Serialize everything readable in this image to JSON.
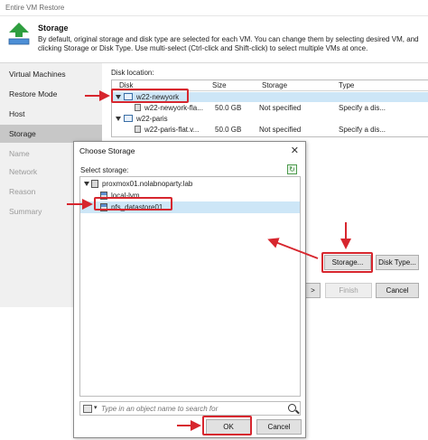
{
  "window": {
    "title": "Entire VM Restore"
  },
  "header": {
    "title": "Storage",
    "description": "By default, original storage and disk type are selected for each VM. You can change them by selecting desired VM, and clicking Storage or Disk Type. Use multi-select (Ctrl-click and Shift-click) to select multiple VMs at once."
  },
  "sidebar": {
    "items": [
      {
        "label": "Virtual Machines",
        "state": "normal"
      },
      {
        "label": "Restore Mode",
        "state": "normal"
      },
      {
        "label": "Host",
        "state": "normal"
      },
      {
        "label": "Storage",
        "state": "active"
      },
      {
        "label": "Name",
        "state": "disabled"
      },
      {
        "label": "Network",
        "state": "disabled"
      },
      {
        "label": "Reason",
        "state": "disabled"
      },
      {
        "label": "Summary",
        "state": "disabled"
      }
    ]
  },
  "disk_location": {
    "label": "Disk location:",
    "columns": [
      "Disk",
      "Size",
      "Storage",
      "Type"
    ],
    "rows": [
      {
        "kind": "vm",
        "name": "w22-newyork",
        "size": "",
        "storage": "",
        "type": ""
      },
      {
        "kind": "disk",
        "name": "w22-newyork-fla...",
        "size": "50.0 GB",
        "storage": "Not specified",
        "type": "Specify a dis..."
      },
      {
        "kind": "vm",
        "name": "w22-paris",
        "size": "",
        "storage": "",
        "type": ""
      },
      {
        "kind": "disk",
        "name": "w22-paris-flat.v...",
        "size": "50.0 GB",
        "storage": "Not specified",
        "type": "Specify a dis..."
      }
    ]
  },
  "wizard_buttons": {
    "storage": "Storage...",
    "disk_type": "Disk Type...",
    "next": ">",
    "finish": "Finish",
    "cancel": "Cancel"
  },
  "dialog": {
    "title": "Choose Storage",
    "close_glyph": "✕",
    "select_label": "Select storage:",
    "tree": {
      "host": "proxmox01.nolabnoparty.lab",
      "storages": [
        "local-lvm",
        "nfs_datastore01"
      ]
    },
    "search": {
      "placeholder": "Type in an object name to search for"
    },
    "ok": "OK",
    "cancel": "Cancel"
  },
  "colors": {
    "annotation_red": "#d7262e",
    "selection_blue": "#cde6f7",
    "sidebar_active": "#c7c7c7",
    "logo_green": "#2e9e3f"
  }
}
